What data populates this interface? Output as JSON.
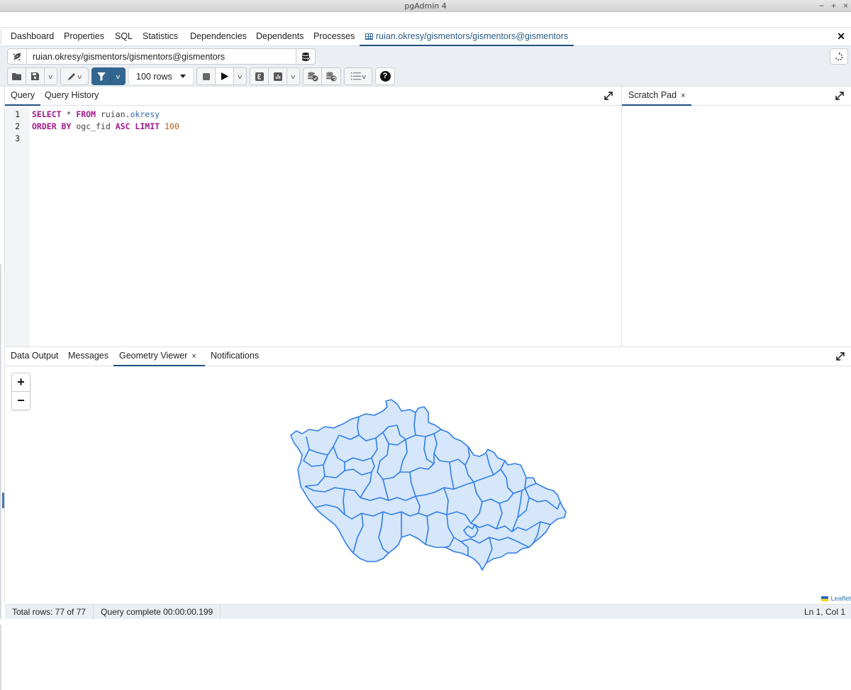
{
  "window": {
    "title": "pgAdmin 4",
    "controls": [
      "−",
      "+",
      "×"
    ]
  },
  "main_tabs": [
    {
      "label": "Dashboard",
      "active": false
    },
    {
      "label": "Properties",
      "active": false
    },
    {
      "label": "SQL",
      "active": false
    },
    {
      "label": "Statistics",
      "active": false
    },
    {
      "label": "Dependencies",
      "active": false
    },
    {
      "label": "Dependents",
      "active": false
    },
    {
      "label": "Processes",
      "active": false
    },
    {
      "label": "ruian.okresy/gismentors/gismentors@gismentors",
      "active": true,
      "icon": "table-grid-icon"
    }
  ],
  "connection": {
    "value": "ruian.okresy/gismentors/gismentors@gismentors"
  },
  "toolbar": {
    "rows_limit": "100 rows"
  },
  "editor": {
    "tabs": [
      {
        "label": "Query",
        "active": true
      },
      {
        "label": "Query History",
        "active": false
      }
    ],
    "line_numbers": [
      "1",
      "2",
      "3"
    ],
    "lines": [
      [
        {
          "t": "SELECT",
          "c": "kw"
        },
        {
          "t": " * ",
          "c": "ident"
        },
        {
          "t": "FROM",
          "c": "kw"
        },
        {
          "t": " ruian.",
          "c": "ident"
        },
        {
          "t": "okresy",
          "c": "prop"
        }
      ],
      [
        {
          "t": "ORDER BY",
          "c": "kw"
        },
        {
          "t": " ogc_fid ",
          "c": "ident"
        },
        {
          "t": "ASC",
          "c": "kw"
        },
        {
          "t": " ",
          "c": "ident"
        },
        {
          "t": "LIMIT",
          "c": "kw"
        },
        {
          "t": " ",
          "c": "ident"
        },
        {
          "t": "100",
          "c": "num"
        }
      ],
      []
    ]
  },
  "scratch_pad": {
    "label": "Scratch Pad",
    "close": "×"
  },
  "output": {
    "tabs": [
      {
        "label": "Data Output",
        "active": false,
        "closable": false
      },
      {
        "label": "Messages",
        "active": false,
        "closable": false
      },
      {
        "label": "Geometry Viewer",
        "active": true,
        "closable": true
      },
      {
        "label": "Notifications",
        "active": false,
        "closable": false
      }
    ],
    "tab_close": "×",
    "zoom_in": "+",
    "zoom_out": "−",
    "attribution": "Leaflet",
    "geometry_fill": "#d6e6fb",
    "geometry_stroke": "#2f7fe8"
  },
  "status": {
    "total_rows": "Total rows: 77 of 77",
    "query_time": "Query complete 00:00:00.199",
    "cursor": "Ln 1, Col 1"
  },
  "colors": {
    "accent": "#1e5180",
    "primary_button": "#326690",
    "keyword": "#a0198c",
    "number": "#b35d1d"
  }
}
